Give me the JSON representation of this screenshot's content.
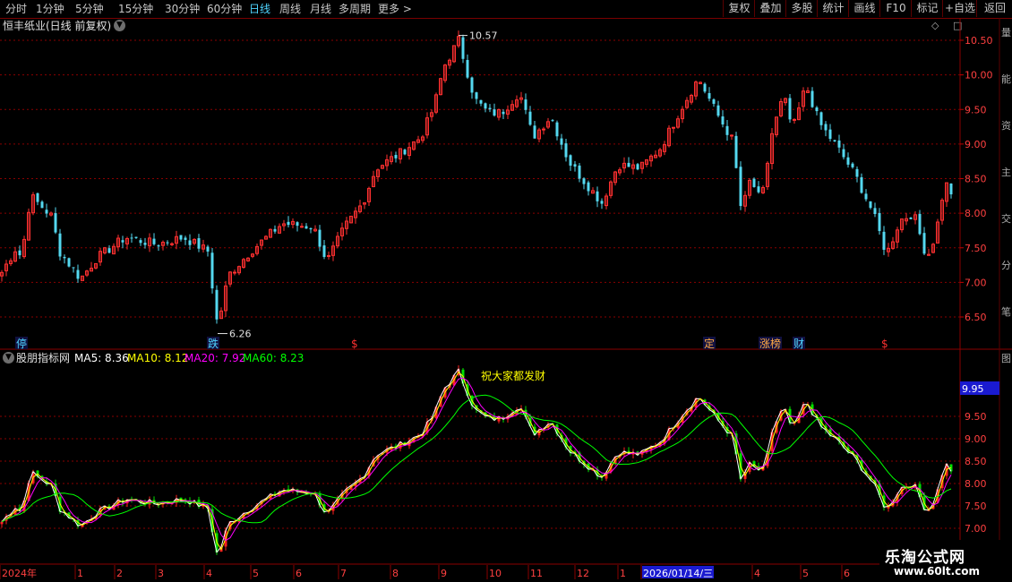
{
  "toolbar": {
    "periods": [
      "分时",
      "1分钟",
      "5分钟",
      "15分钟",
      "30分钟",
      "60分钟",
      "日线",
      "周线",
      "月线",
      "多周期",
      "更多 >"
    ],
    "active_period": "日线",
    "buttons": [
      "复权",
      "叠加",
      "多股",
      "统计",
      "画线",
      "F10",
      "标记",
      "+自选",
      "返回"
    ]
  },
  "title": "恒丰纸业(日线 前复权)",
  "top_icons": "◇ □",
  "price_axis": [
    "10.50",
    "10.00",
    "9.50",
    "9.00",
    "8.50",
    "8.00",
    "7.50",
    "7.00",
    "6.50"
  ],
  "high_label": "10.57",
  "low_label": "6.26",
  "events": [
    {
      "text": "停",
      "color": "#4fd5ff"
    },
    {
      "text": "跌",
      "color": "#4fd5ff"
    },
    {
      "text": "$",
      "color": "#ff3030"
    },
    {
      "text": "定",
      "color": "#ffaa44"
    },
    {
      "text": "涨榜",
      "color": "#ffaa44"
    },
    {
      "text": "财",
      "color": "#4fd5ff"
    },
    {
      "text": "$",
      "color": "#ff3030"
    }
  ],
  "indicator": {
    "name": "股朋指标网",
    "ma5": "MA5: 8.36",
    "ma10": "MA10: 8.12",
    "ma20": "MA20: 7.92",
    "ma60": "MA60: 8.23",
    "annotation": "祝大家都发财",
    "current_value": "9.95",
    "axis": [
      "9.50",
      "9.00",
      "8.50",
      "8.00",
      "7.50",
      "7.00"
    ]
  },
  "colors": {
    "ma5": "#ffffff",
    "ma10": "#ffff00",
    "ma20": "#ff00ff",
    "ma60": "#00ff00",
    "up": "#ff3030",
    "down": "#54d8ef"
  },
  "date_axis": {
    "labels": [
      "2024年",
      "1",
      "2",
      "3",
      "4",
      "5",
      "6",
      "7",
      "8",
      "9",
      "10",
      "11",
      "12",
      "1",
      "2026/01/14/三",
      "4",
      "5",
      "6"
    ]
  },
  "right_strip": [
    "量",
    "能",
    "资",
    "主",
    "交",
    "分",
    "笔",
    "图"
  ],
  "watermark": {
    "line1": "乐淘公式网",
    "line2": "www.60lt.com"
  }
}
